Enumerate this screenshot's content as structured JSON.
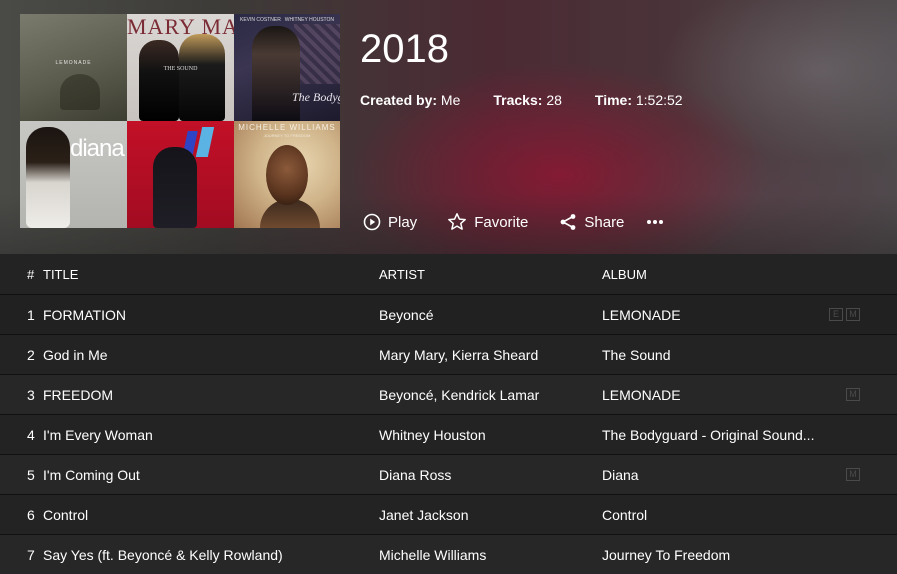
{
  "playlist": {
    "title": "2018",
    "created_by_label": "Created by:",
    "created_by_value": "Me",
    "tracks_label": "Tracks:",
    "tracks_value": "28",
    "time_label": "Time:",
    "time_value": "1:52:52"
  },
  "artwork": {
    "lemonade_text": "LEMONADE",
    "marymary_text": "MARY MARY",
    "marymary_sub": "THE SOUND",
    "bodyguard_top_left": "KEVIN COSTNER",
    "bodyguard_top_right": "WHITNEY HOUSTON",
    "bodyguard_text": "The Bodyguard",
    "diana_text": "diana",
    "michelle_text": "MICHELLE WILLIAMS",
    "michelle_sub": "JOURNEY TO FREEDOM"
  },
  "actions": {
    "play": "Play",
    "favorite": "Favorite",
    "share": "Share",
    "more": "•••"
  },
  "icons": {
    "play": "play-circle-icon",
    "favorite": "star-outline-icon",
    "share": "share-icon",
    "more": "more-dots-icon",
    "explicit": "explicit-badge-icon",
    "music_video": "music-video-badge-icon"
  },
  "table": {
    "headers": {
      "num": "#",
      "title": "TITLE",
      "artist": "ARTIST",
      "album": "ALBUM"
    },
    "rows": [
      {
        "num": "1",
        "title": "FORMATION",
        "artist": "Beyoncé",
        "album": "LEMONADE",
        "badge_e": "E",
        "badge_m": "M"
      },
      {
        "num": "2",
        "title": "God in Me",
        "artist": "Mary Mary, Kierra Sheard",
        "album": "The Sound"
      },
      {
        "num": "3",
        "title": "FREEDOM",
        "artist": "Beyoncé, Kendrick Lamar",
        "album": "LEMONADE",
        "badge_m": "M"
      },
      {
        "num": "4",
        "title": "I'm Every Woman",
        "artist": "Whitney Houston",
        "album": "The Bodyguard - Original Sound..."
      },
      {
        "num": "5",
        "title": "I'm Coming Out",
        "artist": "Diana Ross",
        "album": "Diana",
        "badge_m": "M"
      },
      {
        "num": "6",
        "title": "Control",
        "artist": "Janet Jackson",
        "album": "Control"
      },
      {
        "num": "7",
        "title": "Say Yes (ft. Beyoncé & Kelly Rowland)",
        "artist": "Michelle Williams",
        "album": "Journey To Freedom"
      }
    ]
  },
  "colors": {
    "background": "#232323",
    "header_accent": "#96142f",
    "text": "#ffffff",
    "badge": "#4a4a4a"
  }
}
